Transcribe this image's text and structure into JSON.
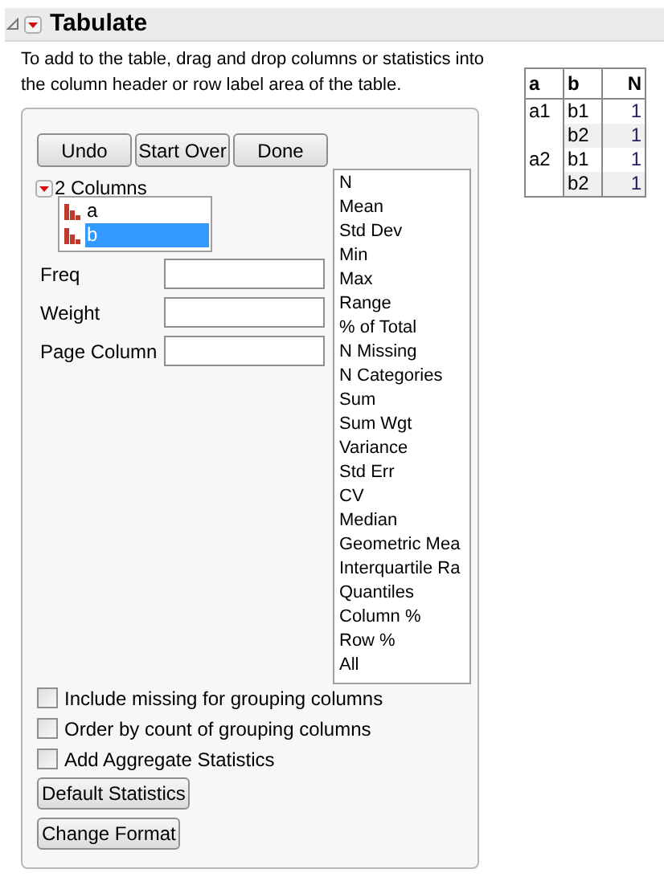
{
  "title": "Tabulate",
  "instructions": "To add to the table, drag and drop columns or statistics into the column header or row label area of the table.",
  "buttons": [
    "Undo",
    "Start Over",
    "Done"
  ],
  "columns_header": "2 Columns",
  "columns": [
    {
      "label": "a",
      "selected": false
    },
    {
      "label": "b",
      "selected": true
    }
  ],
  "fields": [
    {
      "label": "Freq"
    },
    {
      "label": "Weight"
    },
    {
      "label": "Page Column"
    }
  ],
  "statistics": [
    "N",
    "Mean",
    "Std Dev",
    "Min",
    "Max",
    "Range",
    "% of Total",
    "N Missing",
    "N Categories",
    "Sum",
    "Sum Wgt",
    "Variance",
    "Std Err",
    "CV",
    "Median",
    "Geometric Mea",
    "Interquartile Ra",
    "Quantiles",
    "Column %",
    "Row %",
    "All"
  ],
  "options": [
    {
      "label": "Include missing for grouping columns",
      "checked": false
    },
    {
      "label": "Order by count of grouping columns",
      "checked": false
    },
    {
      "label": "Add Aggregate Statistics",
      "checked": false
    }
  ],
  "bottom_buttons": [
    "Default Statistics",
    "Change Format"
  ],
  "table": {
    "columns": [
      "a",
      "b",
      "N"
    ],
    "rows": [
      [
        "a1",
        "b1",
        "1"
      ],
      [
        "",
        "b2",
        "1"
      ],
      [
        "a2",
        "b1",
        "1"
      ],
      [
        "",
        "b2",
        "1"
      ]
    ]
  }
}
